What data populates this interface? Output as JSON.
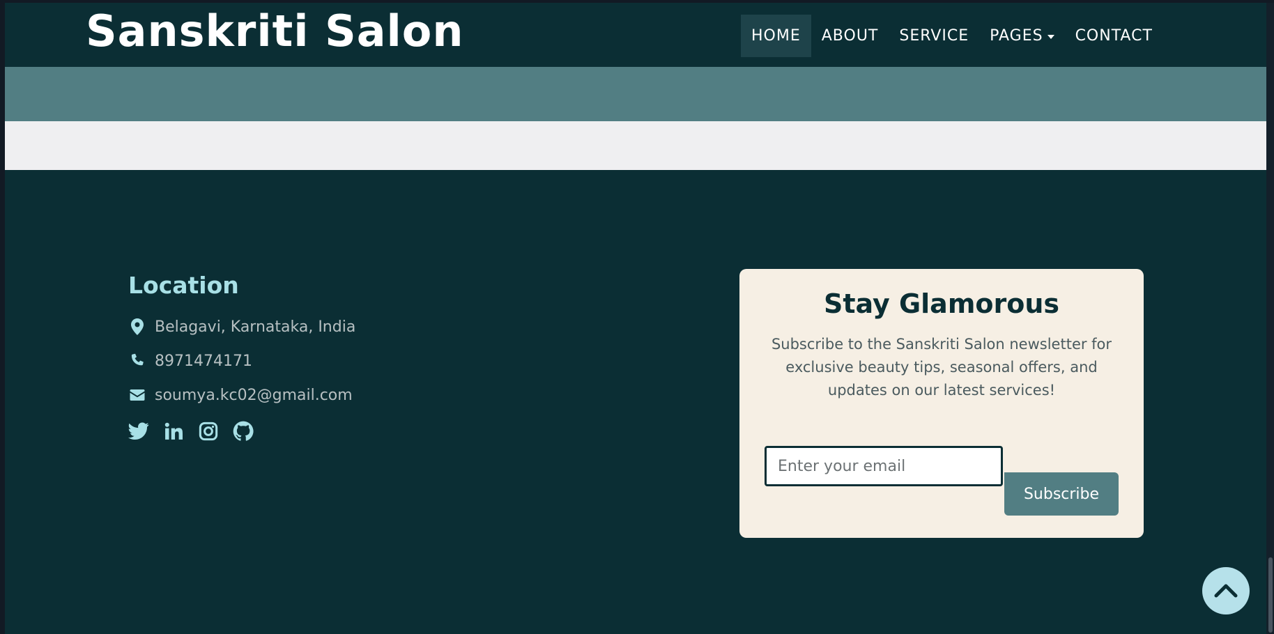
{
  "navbar": {
    "brand": "Sanskriti Salon",
    "items": [
      {
        "label": "HOME",
        "active": true
      },
      {
        "label": "ABOUT",
        "active": false
      },
      {
        "label": "SERVICE",
        "active": false
      },
      {
        "label": "PAGES",
        "active": false,
        "dropdown": true
      },
      {
        "label": "CONTACT",
        "active": false
      }
    ]
  },
  "footer": {
    "location": {
      "title": "Location",
      "address": "Belagavi, Karnataka, India",
      "phone": "8971474171",
      "email": "soumya.kc02@gmail.com"
    },
    "socials": [
      {
        "icon": "twitter-icon"
      },
      {
        "icon": "linkedin-icon"
      },
      {
        "icon": "instagram-icon"
      },
      {
        "icon": "github-icon"
      }
    ],
    "newsletter": {
      "title": "Stay Glamorous",
      "description": "Subscribe to the Sanskriti Salon newsletter for exclusive beauty tips, seasonal offers, and updates on our latest services!",
      "email_placeholder": "Enter your email",
      "email_value": "",
      "button_label": "Subscribe"
    }
  },
  "back_to_top": {
    "icon": "chevron-up-icon"
  },
  "colors": {
    "background": "#0b2e34",
    "accent_teal": "#527e83",
    "heading_light": "#a8e0e6",
    "card_bg": "#f6efe4",
    "to_top_bg": "#b6e1ea"
  }
}
